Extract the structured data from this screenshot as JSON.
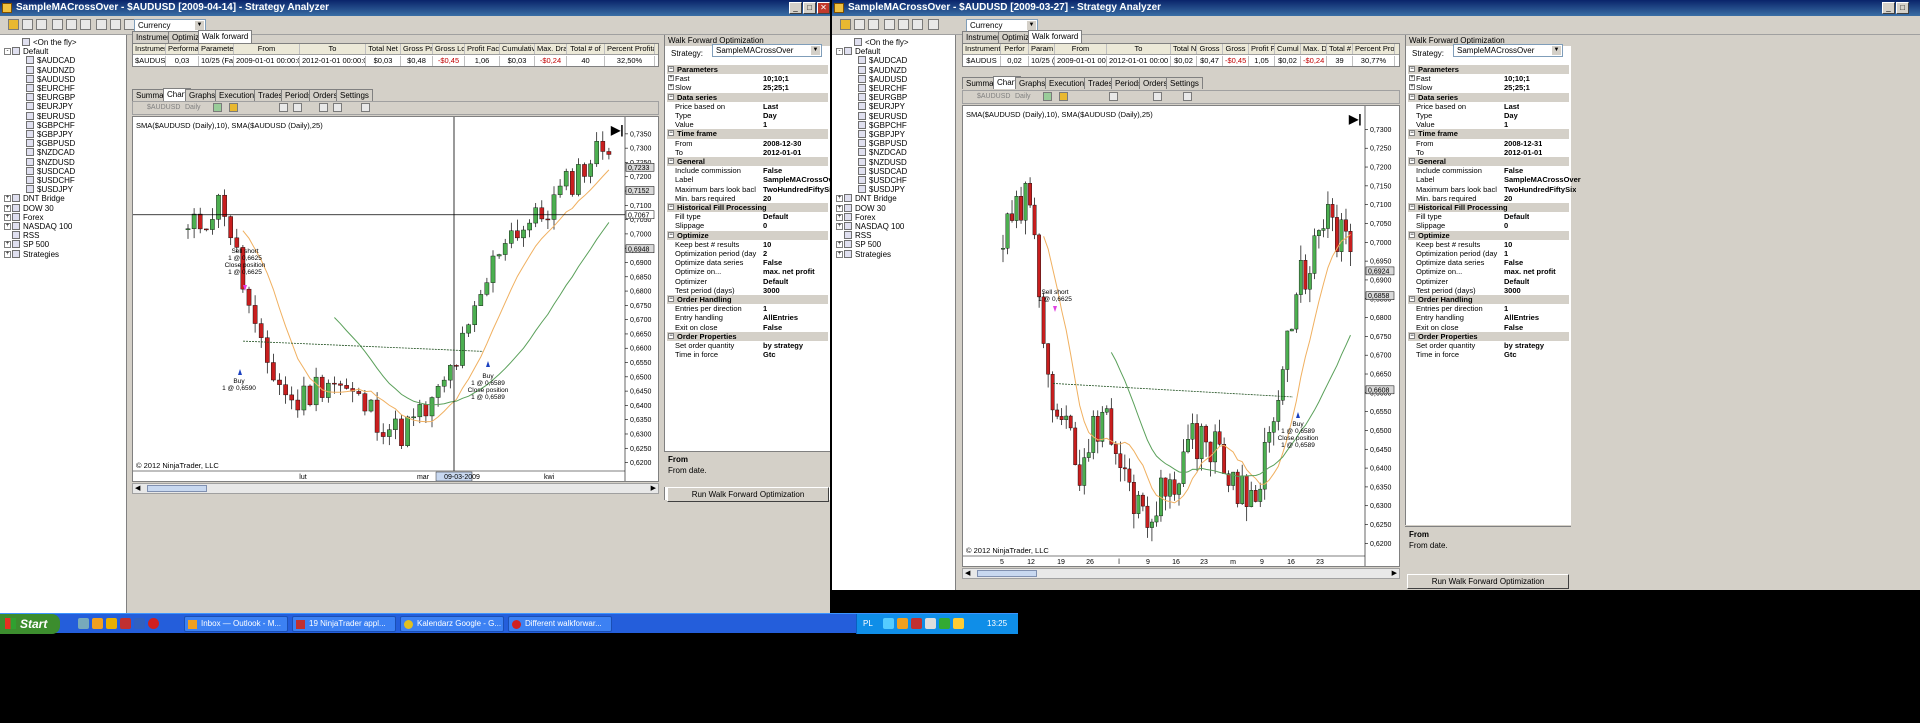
{
  "left": {
    "title": "SampleMACrossOver - $AUDUSD [2009-04-14] - Strategy Analyzer",
    "combo": "Currency",
    "tree": [
      {
        "label": "<On the fly>",
        "level": 1
      },
      {
        "label": "Default",
        "level": 0,
        "exp": "-"
      },
      {
        "label": "$AUDCAD",
        "level": 2
      },
      {
        "label": "$AUDNZD",
        "level": 2
      },
      {
        "label": "$AUDUSD",
        "level": 2
      },
      {
        "label": "$EURCHF",
        "level": 2
      },
      {
        "label": "$EURGBP",
        "level": 2
      },
      {
        "label": "$EURJPY",
        "level": 2
      },
      {
        "label": "$EURUSD",
        "level": 2
      },
      {
        "label": "$GBPCHF",
        "level": 2
      },
      {
        "label": "$GBPJPY",
        "level": 2
      },
      {
        "label": "$GBPUSD",
        "level": 2
      },
      {
        "label": "$NZDCAD",
        "level": 2
      },
      {
        "label": "$NZDUSD",
        "level": 2
      },
      {
        "label": "$USDCAD",
        "level": 2
      },
      {
        "label": "$USDCHF",
        "level": 2
      },
      {
        "label": "$USDJPY",
        "level": 2
      },
      {
        "label": "DNT Bridge",
        "level": 0,
        "exp": "+"
      },
      {
        "label": "DOW 30",
        "level": 0,
        "exp": "+"
      },
      {
        "label": "Forex",
        "level": 0,
        "exp": "+"
      },
      {
        "label": "NASDAQ 100",
        "level": 0,
        "exp": "+"
      },
      {
        "label": "RSS",
        "level": 0
      },
      {
        "label": "SP 500",
        "level": 0,
        "exp": "+"
      },
      {
        "label": "Strategies",
        "level": 0,
        "exp": "+"
      }
    ],
    "top_tabs": [
      "Instruments",
      "Optimizer",
      "Walk forward"
    ],
    "grid_headers": [
      "Instrumen",
      "Performan",
      "Parameter",
      "From",
      "To",
      "Total Net",
      "Gross Pro",
      "Gross Los",
      "Profit Fact",
      "Cumulativ",
      "Max. Dra",
      "Total # of",
      "Percent Profita"
    ],
    "grid_row": [
      "$AUDUS",
      "0,03",
      "10/25 (Fa",
      "2009-01-01 00:00:00",
      "2012-01-01 00:00:00",
      "$0,03",
      "$0,48",
      "-$0,45",
      "1,06",
      "$0,03",
      "-$0,24",
      "40",
      "32,50%"
    ],
    "sub_tabs": [
      "Summary",
      "Chart",
      "Graphs",
      "Executions",
      "Trades",
      "Periods",
      "Orders",
      "Settings"
    ],
    "chart_toolbar": {
      "instrument": "$AUDUSD",
      "period": "Daily"
    },
    "chart_label": "SMA($AUDUSD (Daily),10), SMA($AUDUSD (Daily),25)",
    "copyright": "© 2012 NinjaTrader, LLC",
    "price_ticks": [
      "0,7350",
      "0,7300",
      "0,7250",
      "0,7200",
      "0,7150",
      "0,7100",
      "0,7050",
      "0,7000",
      "0,6950",
      "0,6900",
      "0,6850",
      "0,6800",
      "0,6750",
      "0,6700",
      "0,6650",
      "0,6600",
      "0,6550",
      "0,6500",
      "0,6450",
      "0,6400",
      "0,6350",
      "0,6300",
      "0,6250",
      "0,6200"
    ],
    "price_flags": [
      "0,7233",
      "0,7152",
      "0,7067",
      "0,6948"
    ],
    "x_labels": [
      "lut",
      "mar",
      "09-03-2009",
      "kwi"
    ],
    "annotations": {
      "sell": [
        "Sell short",
        "1 @ 0,6625",
        "Close position",
        "1 @ 0,6625"
      ],
      "buy1": [
        "Buy",
        "1 @ 0,6590"
      ],
      "buy2": [
        "Buy",
        "1 @ 0,6589",
        "Close position",
        "1 @ 0,6589"
      ]
    },
    "panel_title": "Walk Forward Optimization",
    "strategy_label": "Strategy:",
    "strategy": "SampleMACrossOver",
    "props": [
      {
        "cat": "Parameters"
      },
      {
        "k": "Fast",
        "v": "10;10;1",
        "exp": "+"
      },
      {
        "k": "Slow",
        "v": "25;25;1",
        "exp": "+"
      },
      {
        "cat": "Data series"
      },
      {
        "k": "Price based on",
        "v": "Last"
      },
      {
        "k": "Type",
        "v": "Day"
      },
      {
        "k": "Value",
        "v": "1"
      },
      {
        "cat": "Time frame"
      },
      {
        "k": "From",
        "v": "2008-12-30"
      },
      {
        "k": "To",
        "v": "2012-01-01"
      },
      {
        "cat": "General"
      },
      {
        "k": "Include commission",
        "v": "False"
      },
      {
        "k": "Label",
        "v": "SampleMACrossOver"
      },
      {
        "k": "Maximum bars look bacl",
        "v": "TwoHundredFiftySix"
      },
      {
        "k": "Min. bars required",
        "v": "20"
      },
      {
        "cat": "Historical Fill Processing"
      },
      {
        "k": "Fill type",
        "v": "Default"
      },
      {
        "k": "Slippage",
        "v": "0"
      },
      {
        "cat": "Optimize"
      },
      {
        "k": "Keep best # results",
        "v": "10"
      },
      {
        "k": "Optimization period (day",
        "v": "2"
      },
      {
        "k": "Optimize data series",
        "v": "False"
      },
      {
        "k": "Optimize on...",
        "v": "max. net profit"
      },
      {
        "k": "Optimizer",
        "v": "Default"
      },
      {
        "k": "Test period (days)",
        "v": "3000"
      },
      {
        "cat": "Order Handling"
      },
      {
        "k": "Entries per direction",
        "v": "1"
      },
      {
        "k": "Entry handling",
        "v": "AllEntries"
      },
      {
        "k": "Exit on close",
        "v": "False"
      },
      {
        "cat": "Order Properties"
      },
      {
        "k": "Set order quantity",
        "v": "by strategy"
      },
      {
        "k": "Time in force",
        "v": "Gtc"
      }
    ],
    "desc_title": "From",
    "desc_text": "From date.",
    "run_button": "Run Walk Forward Optimization"
  },
  "right": {
    "title": "SampleMACrossOver - $AUDUSD [2009-03-27] - Strategy Analyzer",
    "combo": "Currency",
    "grid_headers": [
      "Instrument",
      "Perfor",
      "Param",
      "From",
      "To",
      "Total N",
      "Gross",
      "Gross",
      "Profit F",
      "Cumul",
      "Max. D",
      "Total #",
      "Percent Prof"
    ],
    "grid_row": [
      "$AUDUS",
      "0,02",
      "10/25 (",
      "2009-01-01 00:00",
      "2012-01-01 00:00",
      "$0,02",
      "$0,47",
      "-$0,45",
      "1,05",
      "$0,02",
      "-$0,24",
      "39",
      "30,77%"
    ],
    "price_ticks": [
      "0,7300",
      "0,7250",
      "0,7200",
      "0,7150",
      "0,7100",
      "0,7050",
      "0,7000",
      "0,6950",
      "0,6900",
      "0,6850",
      "0,6800",
      "0,6750",
      "0,6700",
      "0,6650",
      "0,6600",
      "0,6550",
      "0,6500",
      "0,6450",
      "0,6400",
      "0,6350",
      "0,6300",
      "0,6250",
      "0,6200"
    ],
    "price_flags": [
      "0,6924",
      "0,6858",
      "0,6608"
    ],
    "x_labels": [
      "5",
      "12",
      "19",
      "26",
      "l",
      "9",
      "16",
      "23",
      "m",
      "9",
      "16",
      "23"
    ],
    "annotations": {
      "sell": [
        "Sell short",
        "1 @ 0,6625"
      ],
      "buy": [
        "Buy",
        "1 @ 0,6589",
        "Close position",
        "1 @ 0,6589"
      ]
    },
    "props_override": {
      "From": "2008-12-31",
      "Optimization period (day": "1"
    }
  },
  "taskbar": {
    "start": "Start",
    "tasks": [
      "Inbox — Outlook - M...",
      "19 NinjaTrader appl...",
      "Kalendarz Google - G...",
      "Different walkforwar..."
    ],
    "lang": "PL",
    "clock": "13:25"
  },
  "colors": {
    "up": "#4caf50",
    "down": "#c81e1e",
    "sma_fast": "#f0b060",
    "sma_slow": "#5aa05a",
    "title": "#0a246a"
  }
}
